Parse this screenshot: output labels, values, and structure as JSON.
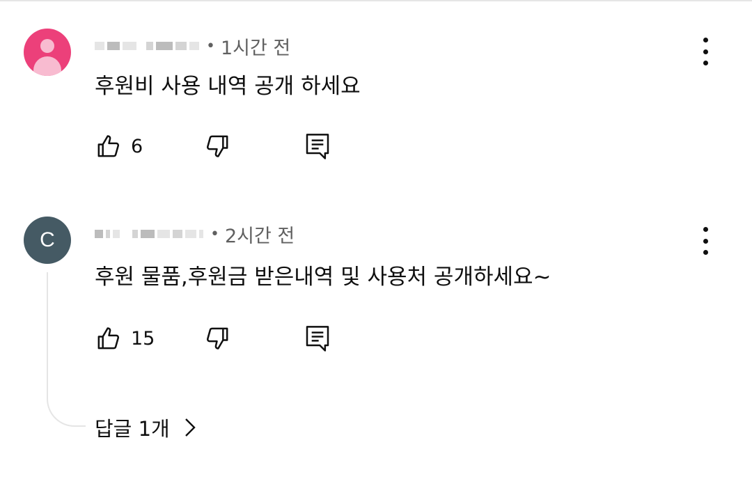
{
  "comments": [
    {
      "avatar": "person-icon",
      "time": "1시간 전",
      "text": "후원비 사용 내역 공개 하세요",
      "likes": "6"
    },
    {
      "avatar_letter": "C",
      "time": "2시간 전",
      "text": "후원 물품,후원금 받은내역 및 사용처 공개하세요~",
      "likes": "15",
      "replies_label": "답글 1개"
    }
  ],
  "icons": {
    "like": "thumbs-up-icon",
    "dislike": "thumbs-down-icon",
    "reply": "comment-icon",
    "menu": "more-vert-icon",
    "replies": "chevron-right-icon"
  },
  "colors": {
    "avatar_pink": "#ec407a",
    "avatar_slate": "#455a64",
    "meta_gray": "#606060"
  }
}
